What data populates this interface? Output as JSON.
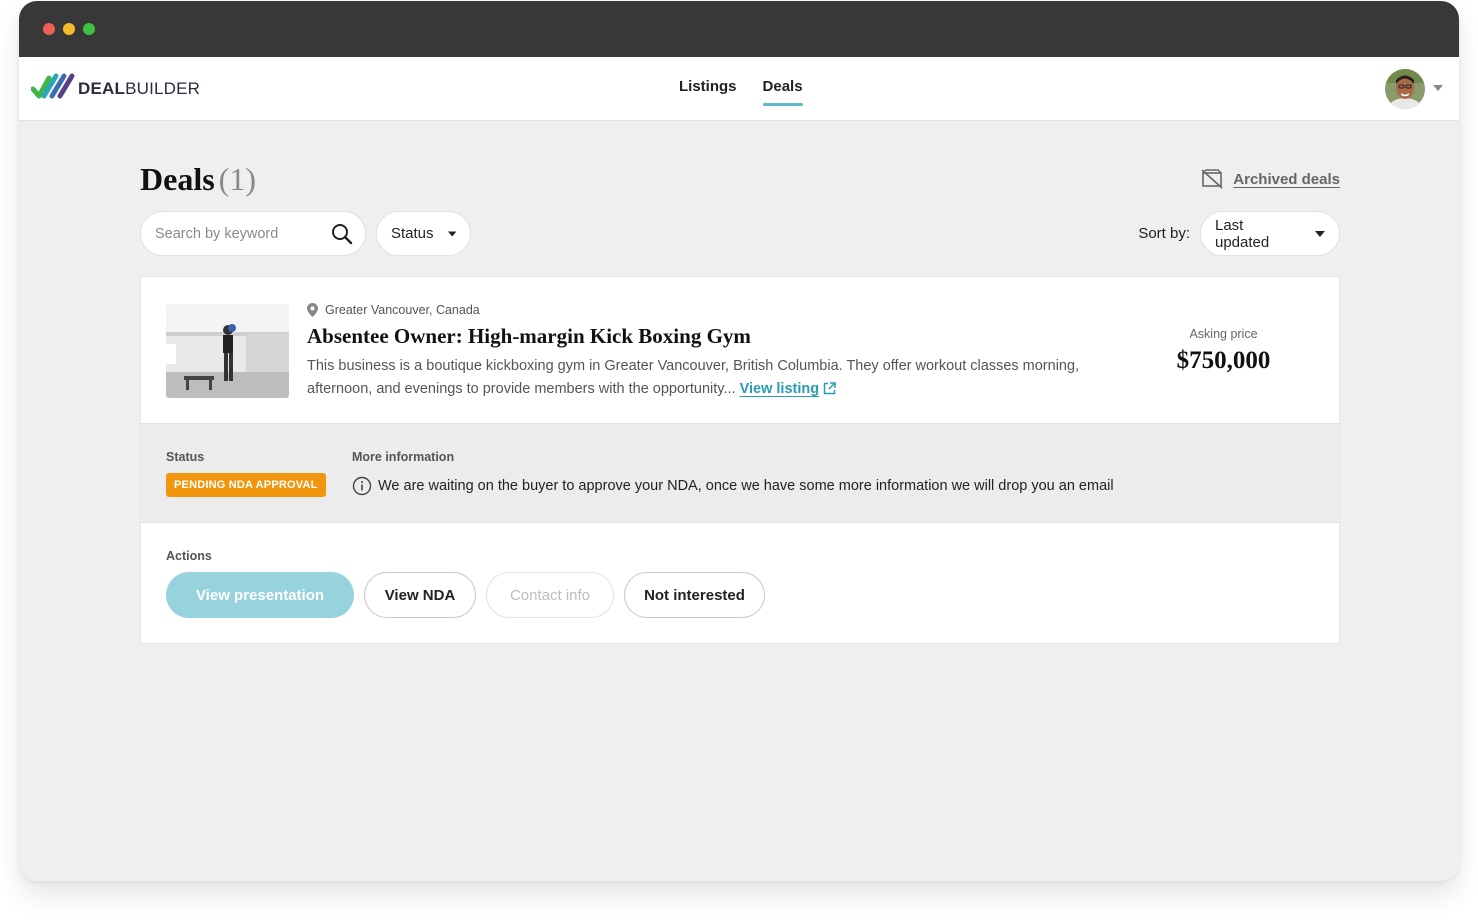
{
  "brand": {
    "name_bold": "DEAL",
    "name_rest": "BUILDER"
  },
  "nav": {
    "items": [
      {
        "label": "Listings"
      },
      {
        "label": "Deals"
      }
    ],
    "active": "Deals"
  },
  "user": {
    "avatar": "user-avatar"
  },
  "page": {
    "title": "Deals",
    "count": "(1)",
    "archived_label": "Archived deals"
  },
  "filters": {
    "search_placeholder": "Search by keyword",
    "status_label": "Status",
    "sort_by_label": "Sort by:",
    "sort_value": "Last updated"
  },
  "deal": {
    "location": "Greater Vancouver, Canada",
    "title": "Absentee Owner: High-margin Kick Boxing Gym",
    "description": "This business is a boutique kickboxing gym in Greater Vancouver, British Columbia. They offer workout classes morning, afternoon, and evenings to provide members with the opportunity...",
    "view_listing_label": "View listing",
    "asking_price_label": "Asking price",
    "asking_price": "$750,000",
    "status_label": "Status",
    "status_value": "PENDING NDA APPROVAL",
    "more_info_label": "More information",
    "more_info_text": "We are waiting on the buyer to approve your NDA, once we have some more information we will drop you an email",
    "actions_label": "Actions",
    "actions": {
      "view_presentation": "View presentation",
      "view_nda": "View NDA",
      "contact_info": "Contact info",
      "not_interested": "Not interested"
    }
  },
  "colors": {
    "accent": "#5bb9c9",
    "link": "#2b9bb4",
    "status_badge": "#f2960e",
    "primary_button_disabled": "#96d3dc",
    "titlebar": "#383838",
    "page_bg": "#efeff0"
  }
}
